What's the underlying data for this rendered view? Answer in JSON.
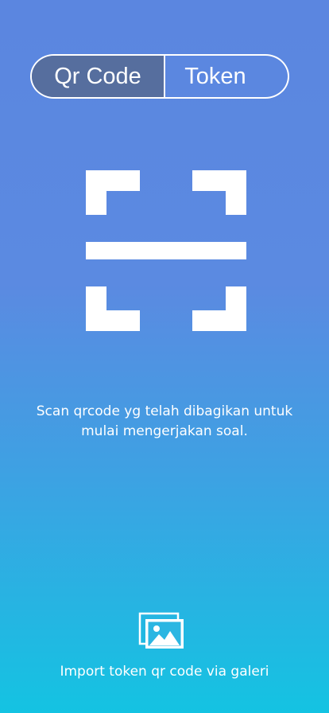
{
  "tabs": {
    "qr_code_label": "Qr Code",
    "token_label": "Token",
    "selected": "Qr Code"
  },
  "scanner": {
    "instruction": "Scan qrcode yg telah dibagikan untuk mulai mengerjakan soal."
  },
  "import": {
    "icon": "gallery-images-icon",
    "label": "Import token qr code via galeri"
  },
  "colors": {
    "background_top": "#5b86e0",
    "background_bottom": "#14c3e2",
    "active_tab": "#566e9e",
    "foreground": "#ffffff"
  }
}
